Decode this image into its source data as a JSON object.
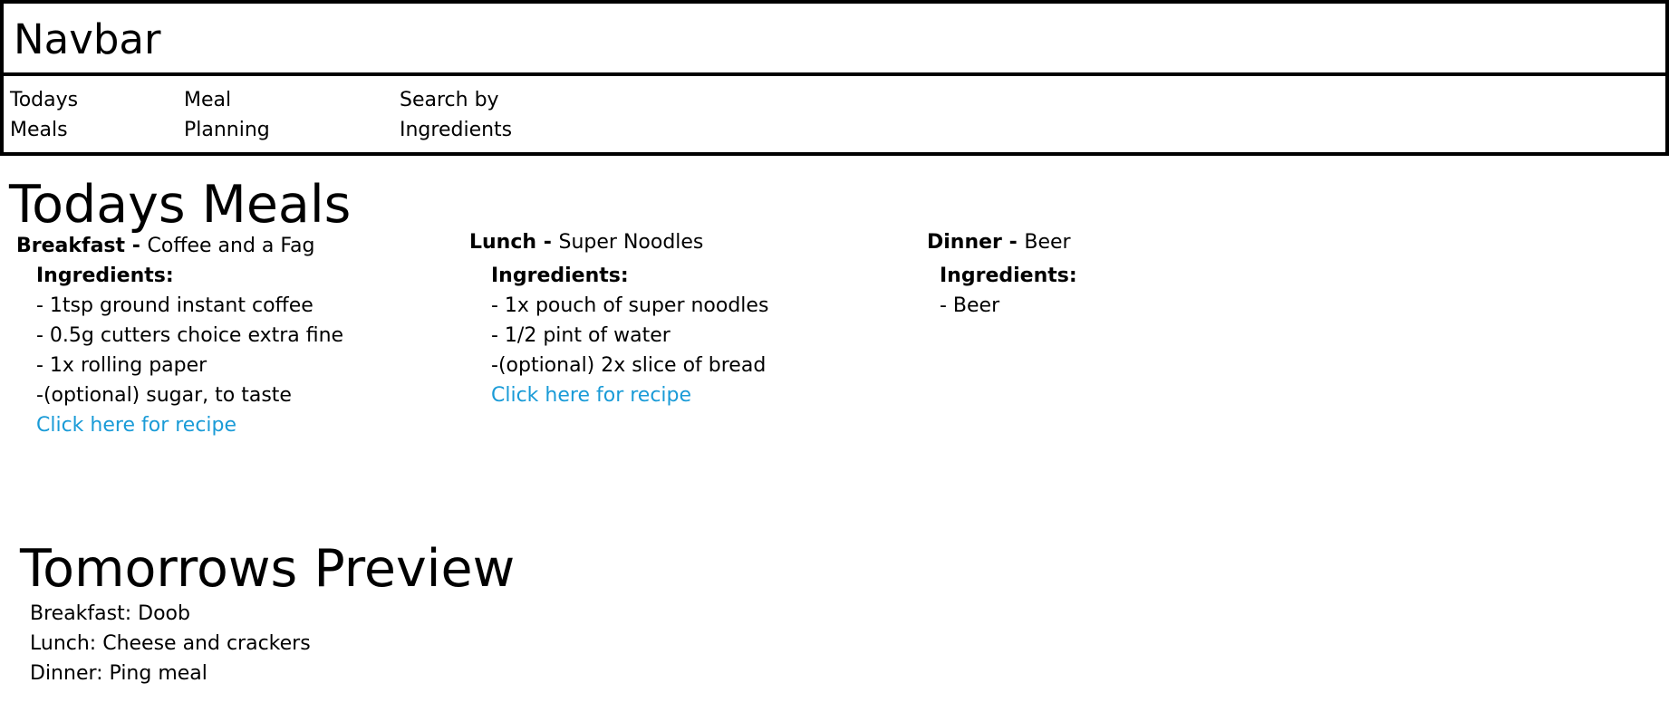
{
  "navbar": {
    "title": "Navbar"
  },
  "nav": {
    "items": [
      {
        "line1": "Todays",
        "line2": "Meals"
      },
      {
        "line1": "Meal",
        "line2": "Planning"
      },
      {
        "line1": "Search by",
        "line2": "Ingredients"
      }
    ]
  },
  "today": {
    "title": "Todays Meals",
    "meals": [
      {
        "type": "Breakfast",
        "separator": " - ",
        "name": "Coffee and a Fag",
        "ingredients_label": "Ingredients:",
        "ingredients": [
          "- 1tsp ground instant coffee",
          "- 0.5g cutters choice extra fine",
          "- 1x rolling paper",
          "-(optional) sugar, to taste"
        ],
        "recipe_link": "Click here for recipe"
      },
      {
        "type": "Lunch",
        "separator": " - ",
        "name": "Super Noodles",
        "ingredients_label": "Ingredients:",
        "ingredients": [
          "- 1x pouch of super noodles",
          "- 1/2 pint of water",
          "-(optional) 2x slice of bread"
        ],
        "recipe_link": "Click here for recipe"
      },
      {
        "type": "Dinner",
        "separator": " - ",
        "name": "Beer",
        "ingredients_label": "Ingredients:",
        "ingredients": [
          "- Beer"
        ]
      }
    ]
  },
  "tomorrow": {
    "title": "Tomorrows Preview",
    "items": [
      "Breakfast: Doob",
      "Lunch: Cheese and crackers",
      "Dinner: Ping meal"
    ]
  },
  "colors": {
    "link": "#1a9bd7",
    "border": "#000000"
  }
}
